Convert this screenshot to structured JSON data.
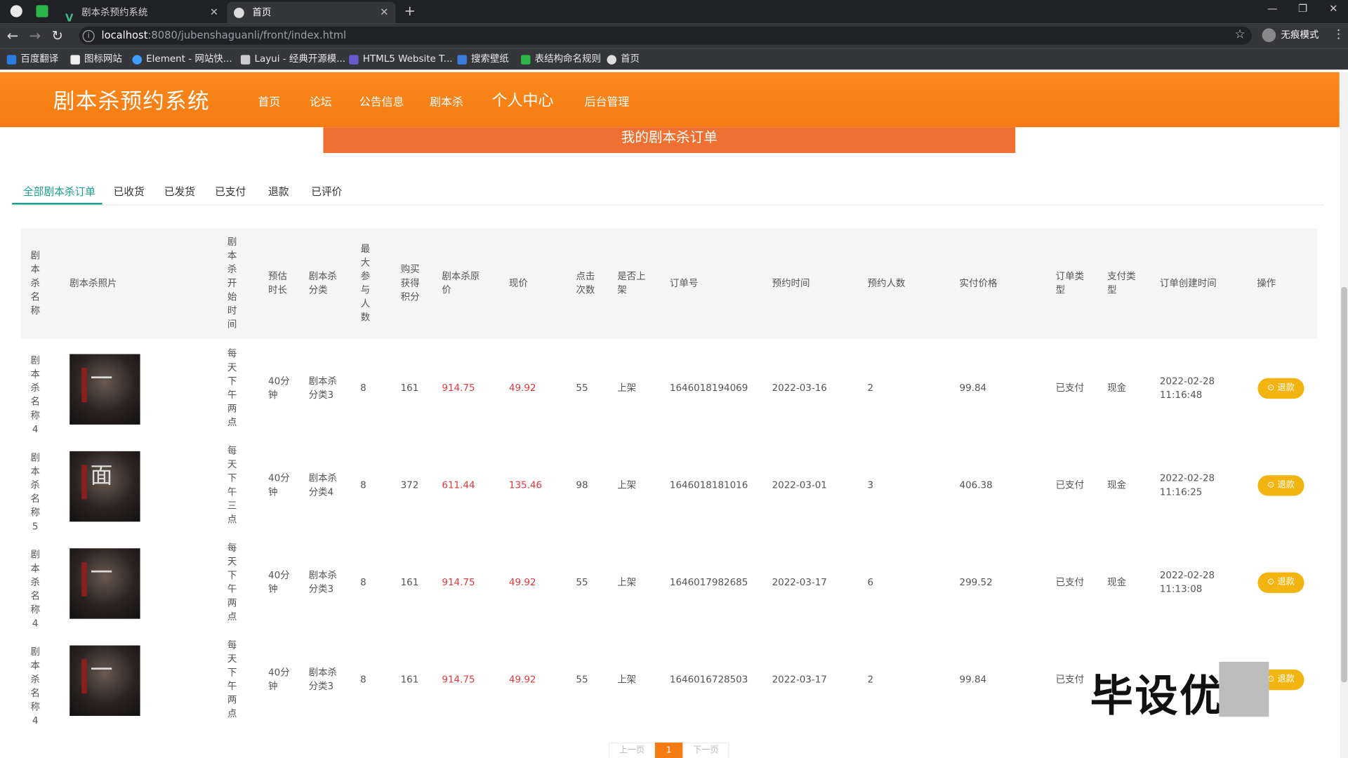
{
  "browser": {
    "tabs": [
      {
        "label": "剧本杀预约系统"
      },
      {
        "label": "首页"
      }
    ],
    "url_host": "localhost",
    "url_path": ":8080/jubenshaguanli/front/index.html",
    "profile_label": "无痕模式",
    "bookmarks": [
      {
        "label": "百度翻译"
      },
      {
        "label": "图标网站"
      },
      {
        "label": "Element - 网站快..."
      },
      {
        "label": "Layui - 经典开源模..."
      },
      {
        "label": "HTML5 Website T..."
      },
      {
        "label": "搜索壁纸"
      },
      {
        "label": "表结构命名规则"
      },
      {
        "label": "首页"
      }
    ]
  },
  "site": {
    "title": "剧本杀预约系统",
    "nav": [
      {
        "label": "首页"
      },
      {
        "label": "论坛"
      },
      {
        "label": "公告信息"
      },
      {
        "label": "剧本杀"
      },
      {
        "label": "个人中心"
      },
      {
        "label": "后台管理"
      }
    ],
    "banner": "我的剧本杀订单"
  },
  "order_tabs": [
    {
      "label": "全部剧本杀订单"
    },
    {
      "label": "已收货"
    },
    {
      "label": "已发货"
    },
    {
      "label": "已支付"
    },
    {
      "label": "退款"
    },
    {
      "label": "已评价"
    }
  ],
  "table": {
    "headers": [
      "剧本杀名称",
      "剧本杀照片",
      "剧本杀开始时间",
      "预估时长",
      "剧本杀分类",
      "最大参与人数",
      "购买获得积分",
      "剧本杀原价",
      "现价",
      "点击次数",
      "是否上架",
      "订单号",
      "预约时间",
      "预约人数",
      "实付价格",
      "订单类型",
      "支付类型",
      "订单创建时间",
      "操作"
    ],
    "rows": [
      {
        "name": "剧本杀名称4",
        "start": "每天下午两点",
        "duration": "40分钟",
        "category": "剧本杀分类3",
        "max": "8",
        "points": "161",
        "orig": "914.75",
        "now": "49.92",
        "clicks": "55",
        "onshelf": "上架",
        "order_no": "1646018194069",
        "book_time": "2022-03-16",
        "people": "2",
        "paid": "99.84",
        "otype": "已支付",
        "ptype": "现金",
        "created_date": "2022-02-28",
        "created_time": "11:16:48",
        "action": "退款"
      },
      {
        "name": "剧本杀名称5",
        "start": "每天下午三点",
        "duration": "40分钟",
        "category": "剧本杀分类4",
        "max": "8",
        "points": "372",
        "orig": "611.44",
        "now": "135.46",
        "clicks": "98",
        "onshelf": "上架",
        "order_no": "1646018181016",
        "book_time": "2022-03-01",
        "people": "3",
        "paid": "406.38",
        "otype": "已支付",
        "ptype": "现金",
        "created_date": "2022-02-28",
        "created_time": "11:16:25",
        "action": "退款"
      },
      {
        "name": "剧本杀名称4",
        "start": "每天下午两点",
        "duration": "40分钟",
        "category": "剧本杀分类3",
        "max": "8",
        "points": "161",
        "orig": "914.75",
        "now": "49.92",
        "clicks": "55",
        "onshelf": "上架",
        "order_no": "1646017982685",
        "book_time": "2022-03-17",
        "people": "6",
        "paid": "299.52",
        "otype": "已支付",
        "ptype": "现金",
        "created_date": "2022-02-28",
        "created_time": "11:13:08",
        "action": "退款"
      },
      {
        "name": "剧本杀名称4",
        "start": "每天下午两点",
        "duration": "40分钟",
        "category": "剧本杀分类3",
        "max": "8",
        "points": "161",
        "orig": "914.75",
        "now": "49.92",
        "clicks": "55",
        "onshelf": "上架",
        "order_no": "1646016728503",
        "book_time": "2022-03-17",
        "people": "2",
        "paid": "99.84",
        "otype": "已支付",
        "ptype": "",
        "created_date": "",
        "created_time": "",
        "action": "退款"
      }
    ]
  },
  "pager": {
    "prev": "上一页",
    "current": "1",
    "next": "下一页"
  },
  "watermark": "毕设优"
}
